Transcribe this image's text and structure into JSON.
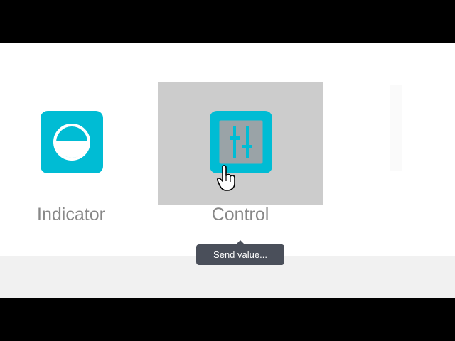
{
  "colors": {
    "accent": "#00bcd4",
    "hover": "#cccccc",
    "tooltip_bg": "#4a4f5a",
    "label": "#888888"
  },
  "tiles": [
    {
      "label": "Indicator",
      "icon": "indicator-half-circle-icon"
    },
    {
      "label": "Control",
      "icon": "sliders-control-icon"
    }
  ],
  "tooltip": {
    "text": "Send value..."
  },
  "cursor": {
    "icon": "hand-pointer-icon"
  }
}
